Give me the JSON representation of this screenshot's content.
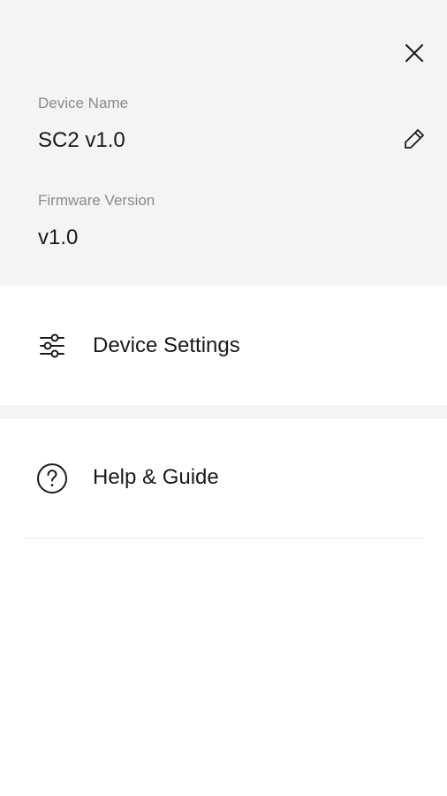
{
  "header": {
    "device_name_label": "Device Name",
    "device_name_value": "SC2 v1.0",
    "firmware_label": "Firmware Version",
    "firmware_value": "v1.0",
    "close_icon": "close-icon",
    "edit_icon": "pencil-icon"
  },
  "menu": {
    "items": [
      {
        "label": "Device Settings",
        "icon": "sliders-icon"
      },
      {
        "label": "Help & Guide",
        "icon": "help-circle-icon"
      }
    ]
  },
  "colors": {
    "header_background": "#f4f4f4",
    "label_text": "#8a8a8a",
    "primary_text": "#1a1a1a",
    "divider": "#ececec"
  }
}
